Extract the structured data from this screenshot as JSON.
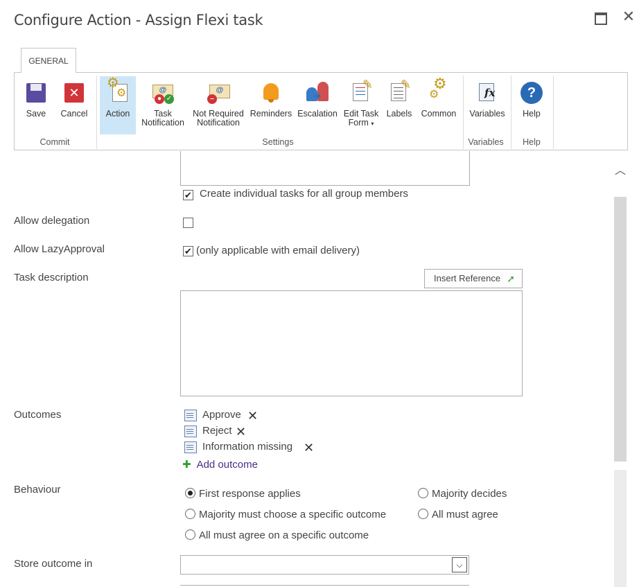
{
  "window": {
    "title": "Configure Action - Assign Flexi task",
    "maximize_icon": "maximize-icon",
    "close_icon": "close-icon",
    "close_glyph": "✕"
  },
  "ribbon": {
    "tab_label": "GENERAL",
    "buttons": [
      {
        "label": "Save",
        "icon": "save-icon"
      },
      {
        "label": "Cancel",
        "icon": "cancel-icon"
      },
      {
        "label": "Action",
        "icon": "action-gears-icon",
        "selected": true
      },
      {
        "label": "Task",
        "label2": "Notification",
        "icon": "task-notification-icon"
      },
      {
        "label": "Not Required",
        "label2": "Notification",
        "icon": "not-required-notification-icon"
      },
      {
        "label": "Reminders",
        "icon": "bell-icon"
      },
      {
        "label": "Escalation",
        "icon": "escalation-icon"
      },
      {
        "label": "Edit Task",
        "label2": "Form",
        "icon": "edit-task-form-icon"
      },
      {
        "label": "Labels",
        "icon": "labels-icon"
      },
      {
        "label": "Common",
        "icon": "common-gears-icon"
      },
      {
        "label": "Variables",
        "icon": "variables-fx-icon"
      },
      {
        "label": "Help",
        "icon": "help-icon"
      }
    ],
    "groups": {
      "commit": "Commit",
      "settings": "Settings",
      "variables": "Variables",
      "help": "Help"
    }
  },
  "form": {
    "create_individual_tasks": {
      "label": "Create individual tasks for all group members",
      "checked": true
    },
    "allow_delegation": {
      "label": "Allow delegation",
      "checked": false
    },
    "allow_lazy_approval": {
      "label": "Allow LazyApproval",
      "checked": true,
      "note": "(only applicable with email delivery)"
    },
    "task_description": {
      "label": "Task description",
      "insert_reference": "Insert Reference",
      "value": ""
    },
    "outcomes": {
      "label": "Outcomes",
      "items": [
        "Approve",
        "Reject",
        "Information missing"
      ],
      "add_label": "Add outcome",
      "remove_icon": "remove-x-icon"
    },
    "behaviour": {
      "label": "Behaviour",
      "options": [
        {
          "label": "First response applies",
          "checked": true
        },
        {
          "label": "Majority decides",
          "checked": false
        },
        {
          "label": "Majority must choose a specific outcome",
          "checked": false
        },
        {
          "label": "All must agree",
          "checked": false
        },
        {
          "label": "All must agree on a specific outcome",
          "checked": false
        }
      ]
    },
    "store_outcome": {
      "label": "Store outcome in",
      "value": ""
    }
  },
  "colors": {
    "accent_selected": "#cde6f7",
    "link": "#4c2d86",
    "border": "#ababab"
  }
}
